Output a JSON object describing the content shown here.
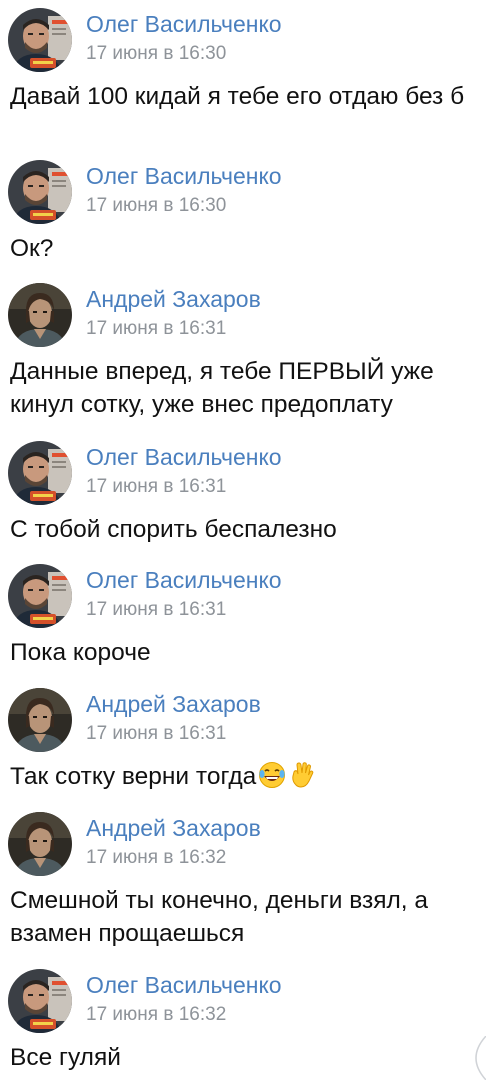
{
  "messages": [
    {
      "author": "Олег Васильченко",
      "time": "17 июня в 16:30",
      "text": "Давай 100 кидай я тебе его отдаю без б",
      "avatar": "oleg"
    },
    {
      "author": "Олег Васильченко",
      "time": "17 июня в 16:30",
      "text": "Ок?",
      "avatar": "oleg"
    },
    {
      "author": "Андрей Захаров",
      "time": "17 июня в 16:31",
      "text": "Данные вперед, я тебе ПЕРВЫЙ уже кинул сотку, уже внес предоплату",
      "avatar": "andrey"
    },
    {
      "author": "Олег Васильченко",
      "time": "17 июня в 16:31",
      "text": "С тобой спорить беспалезно",
      "avatar": "oleg"
    },
    {
      "author": "Олег Васильченко",
      "time": "17 июня в 16:31",
      "text": "Пока короче",
      "avatar": "oleg"
    },
    {
      "author": "Андрей Захаров",
      "time": "17 июня в 16:31",
      "text": "Так сотку верни тогда",
      "avatar": "andrey",
      "emojis": [
        "laughing-tears-icon",
        "raised-hand-icon"
      ]
    },
    {
      "author": "Андрей Захаров",
      "time": "17 июня в 16:32",
      "text": "Смешной ты конечно, деньги взял, а взамен прощаешься",
      "avatar": "andrey"
    },
    {
      "author": "Олег Васильченко",
      "time": "17 июня в 16:32",
      "text": "Все гуляй",
      "avatar": "oleg"
    }
  ],
  "colors": {
    "author_name": "#4a7fbe",
    "timestamp": "#8e9399",
    "message_text": "#111111",
    "background": "#ffffff"
  }
}
